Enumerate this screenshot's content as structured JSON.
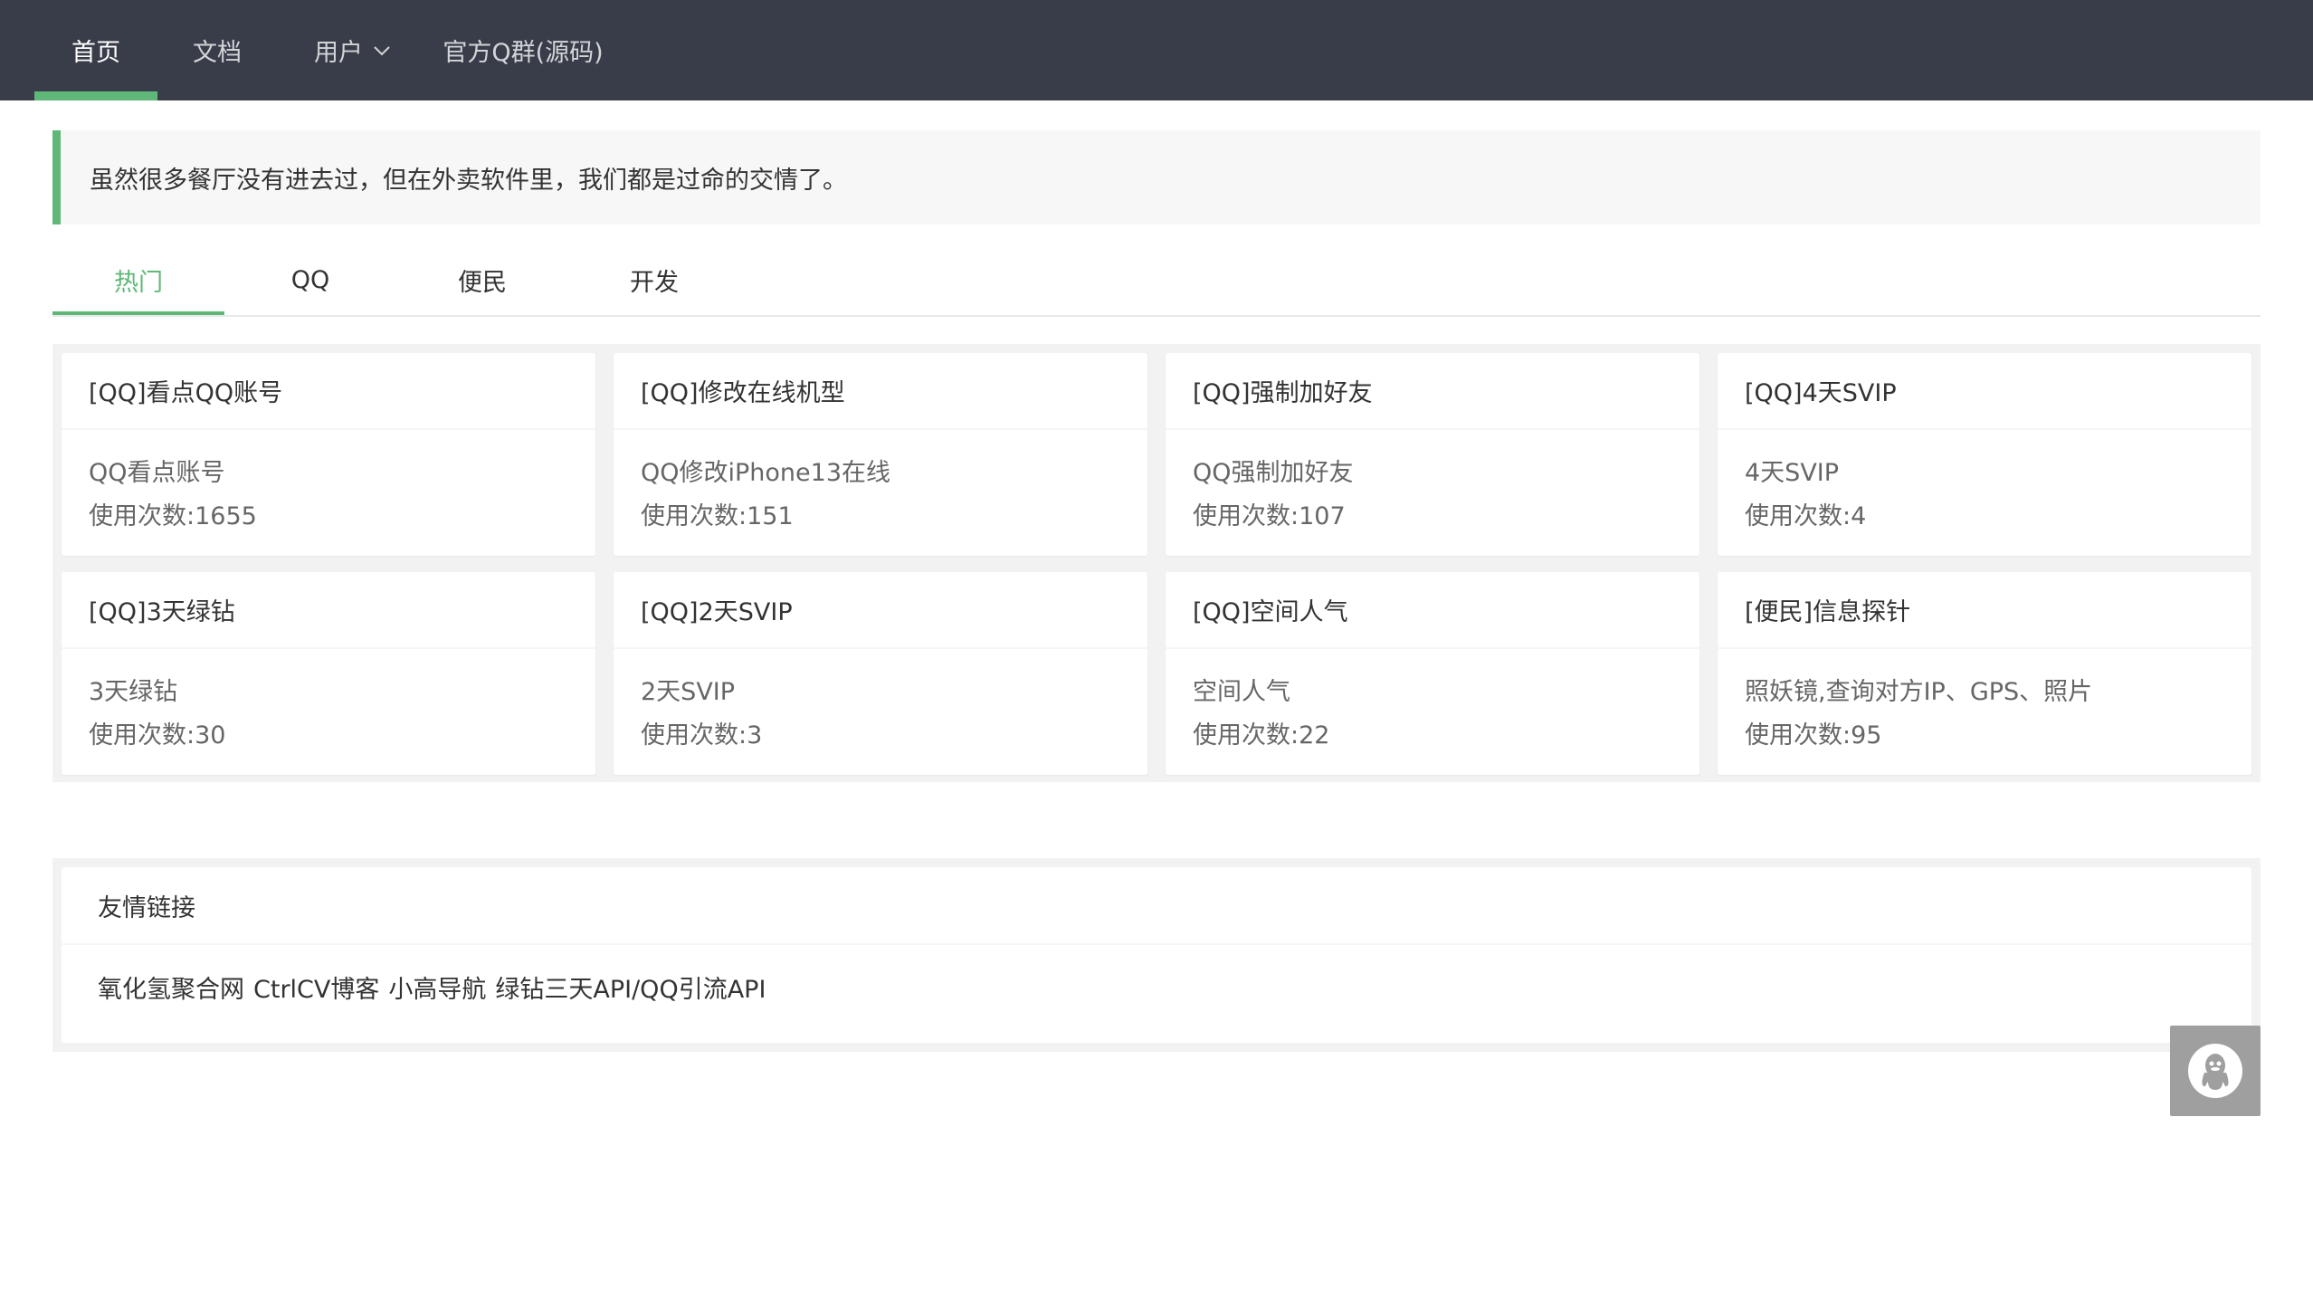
{
  "nav": {
    "items": [
      {
        "label": "首页",
        "active": true
      },
      {
        "label": "文档",
        "active": false
      },
      {
        "label": "用户",
        "active": false,
        "dropdown": true
      },
      {
        "label": "官方Q群(源码)",
        "active": false
      }
    ]
  },
  "notice": {
    "text": "虽然很多餐厅没有进去过，但在外卖软件里，我们都是过命的交情了。"
  },
  "tabs": [
    {
      "label": "热门",
      "active": true
    },
    {
      "label": "QQ",
      "active": false
    },
    {
      "label": "便民",
      "active": false
    },
    {
      "label": "开发",
      "active": false
    }
  ],
  "cards": [
    {
      "title": "[QQ]看点QQ账号",
      "desc": "QQ看点账号",
      "usage": "使用次数:1655"
    },
    {
      "title": "[QQ]修改在线机型",
      "desc": "QQ修改iPhone13在线",
      "usage": "使用次数:151"
    },
    {
      "title": "[QQ]强制加好友",
      "desc": "QQ强制加好友",
      "usage": "使用次数:107"
    },
    {
      "title": "[QQ]4天SVIP",
      "desc": "4天SVIP",
      "usage": "使用次数:4"
    },
    {
      "title": "[QQ]3天绿钻",
      "desc": "3天绿钻",
      "usage": "使用次数:30"
    },
    {
      "title": "[QQ]2天SVIP",
      "desc": "2天SVIP",
      "usage": "使用次数:3"
    },
    {
      "title": "[QQ]空间人气",
      "desc": "空间人气",
      "usage": "使用次数:22"
    },
    {
      "title": "[便民]信息探针",
      "desc": "照妖镜,查询对方IP、GPS、照片",
      "usage": "使用次数:95"
    }
  ],
  "links": {
    "title": "友情链接",
    "items": [
      "氧化氢聚合网",
      "CtrlCV博客",
      "小高导航",
      "绿钻三天API/QQ引流API"
    ]
  },
  "float_button": {
    "icon": "qq-penguin-icon"
  },
  "colors": {
    "nav_bg": "#393d49",
    "accent": "#5fb878",
    "panel_bg": "#f2f2f2",
    "float_btn_bg": "#9f9f9f"
  }
}
